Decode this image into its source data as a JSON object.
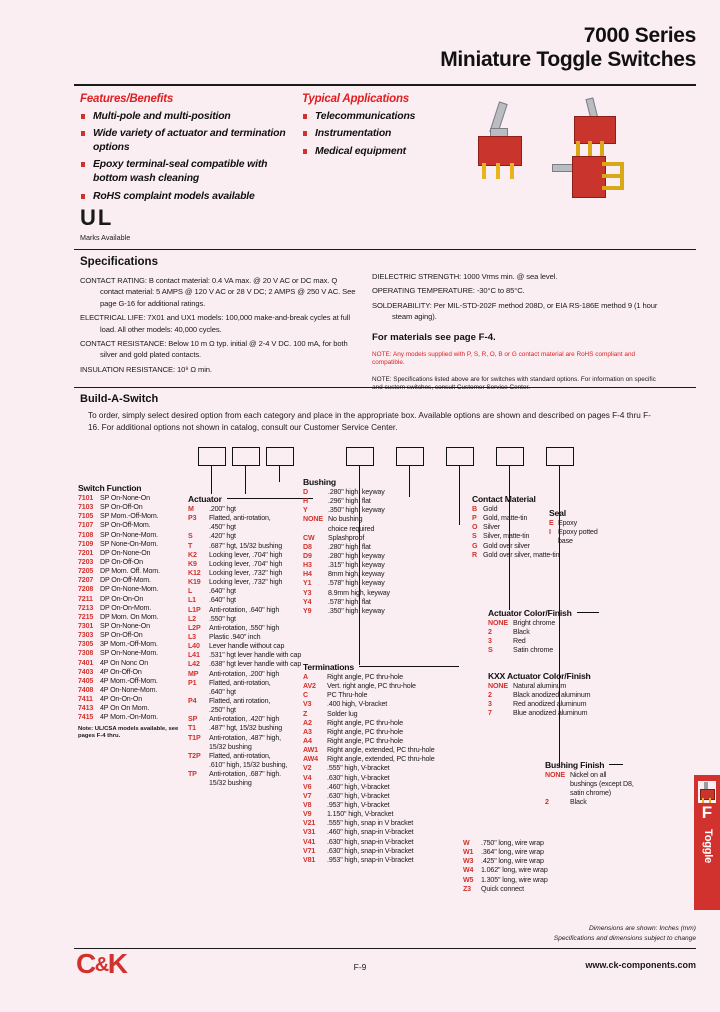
{
  "header": {
    "series": "7000 Series",
    "title": "Miniature Toggle Switches"
  },
  "features": {
    "heading": "Features/Benefits",
    "items": [
      "Multi-pole and multi-position",
      "Wide variety of actuator and termination options",
      "Epoxy terminal-seal compatible with bottom wash cleaning",
      "RoHS complaint models available"
    ]
  },
  "applications": {
    "heading": "Typical Applications",
    "items": [
      "Telecommunications",
      "Instrumentation",
      "Medical equipment"
    ]
  },
  "marks": {
    "glyphs": "UL",
    "note": "Marks Available"
  },
  "specifications": {
    "heading": "Specifications",
    "left": [
      "CONTACT RATING: B contact material: 0.4 VA max. @ 20 V AC or DC max. Q contact material: 5 AMPS @ 120 V AC or 28 V DC; 2 AMPS @ 250 V AC. See page G-16 for additional ratings.",
      "ELECTRICAL LIFE: 7X01 and UX1 models: 100,000 make-and-break cycles at full load. All other models: 40,000 cycles.",
      "CONTACT RESISTANCE: Below 10 m Ω typ. initial @ 2-4 V DC. 100 mA, for both silver and gold plated contacts.",
      "INSULATION RESISTANCE: 10⁹ Ω min."
    ],
    "right": [
      "DIELECTRIC STRENGTH: 1000 Vrms min. @ sea level.",
      "OPERATING TEMPERATURE: -30°C to 85°C.",
      "SOLDERABILITY: Per MIL-STD-202F method 208D, or EIA RS-186E method 9 (1 hour steam aging)."
    ],
    "materials_line": "For materials see page F-4.",
    "note_red": "NOTE: Any models supplied with P, S, R, O, B or G contact material are RoHS compliant and compatible.",
    "note_black": "NOTE: Specifications listed above are for switches with standard options. For information on specific and custom switches, consult Customer Service Center."
  },
  "build": {
    "heading": "Build-A-Switch",
    "intro": "To order, simply select desired option from each category and place in the appropriate box. Available options are shown and described on pages F-4 thru F-16. For additional options not shown in catalog, consult our Customer Service Center."
  },
  "columns": {
    "switch_function": {
      "title": "Switch Function",
      "rows": [
        {
          "code": "7101",
          "desc": "SP On-None-On"
        },
        {
          "code": "7103",
          "desc": "SP On-Off-On"
        },
        {
          "code": "7105",
          "desc": "SP Mom.-Off-Mom."
        },
        {
          "code": "7107",
          "desc": "SP On-Off-Mom."
        },
        {
          "code": "7108",
          "desc": "SP On-None-Mom."
        },
        {
          "code": "7109",
          "desc": "SP None-On-Mom."
        },
        {
          "code": "7201",
          "desc": "DP On-None-On"
        },
        {
          "code": "7203",
          "desc": "DP On-Off-On"
        },
        {
          "code": "7205",
          "desc": "DP Mom. Off. Mom."
        },
        {
          "code": "7207",
          "desc": "DP On-Off-Mom."
        },
        {
          "code": "7208",
          "desc": "DP On-None-Mom."
        },
        {
          "code": "7211",
          "desc": "DP On-On-On"
        },
        {
          "code": "7213",
          "desc": "DP On-On-Mom."
        },
        {
          "code": "7215",
          "desc": "DP Mom. On Mom."
        },
        {
          "code": "7301",
          "desc": "SP On-None-On"
        },
        {
          "code": "7303",
          "desc": "SP On-Off-On"
        },
        {
          "code": "7305",
          "desc": "3P Mom.-Off-Mom."
        },
        {
          "code": "7308",
          "desc": "SP On-None-Mom."
        },
        {
          "code": "7401",
          "desc": "4P On Nonc On"
        },
        {
          "code": "7403",
          "desc": "4P On-Off-On"
        },
        {
          "code": "7405",
          "desc": "4P Mom.-Off-Mom."
        },
        {
          "code": "7408",
          "desc": "4P On-None-Mom."
        },
        {
          "code": "7411",
          "desc": "4P On-On-On"
        },
        {
          "code": "7413",
          "desc": "4P On On Mom."
        },
        {
          "code": "7415",
          "desc": "4P Mom.-On-Mom."
        }
      ],
      "note": "Note: UL/CSA models available, see pages F-4 thru."
    },
    "actuator": {
      "title": "Actuator",
      "rows": [
        {
          "code": "M",
          "desc": ".200\" hgt"
        },
        {
          "code": "P3",
          "desc": "Flatted, anti-rotation,"
        },
        {
          "code": "",
          "desc": ".450\" hgt"
        },
        {
          "code": "S",
          "desc": ".420\" hgt"
        },
        {
          "code": "T",
          "desc": ".687\" hgt, 15/32 bushing"
        },
        {
          "code": "K2",
          "desc": "Locking lever, .704\" high"
        },
        {
          "code": "K9",
          "desc": "Locking lever, .704\" high"
        },
        {
          "code": "K12",
          "desc": "Locking lever, .732\" high"
        },
        {
          "code": "K19",
          "desc": "Locking lever, .732\" high"
        },
        {
          "code": "L",
          "desc": ".640\" hgt"
        },
        {
          "code": "L1",
          "desc": ".640\" hgt"
        },
        {
          "code": "L1P",
          "desc": "Anti-rotation, .640\" high"
        },
        {
          "code": "L2",
          "desc": ".550\" hgt"
        },
        {
          "code": "L2P",
          "desc": "Anti-rotation, .550\" high"
        },
        {
          "code": "L3",
          "desc": "Plastic .940\" inch"
        },
        {
          "code": "L40",
          "desc": "Lever handle without cap"
        },
        {
          "code": "L41",
          "desc": ".531\" hgt lever handle with cap"
        },
        {
          "code": "L42",
          "desc": ".638\" hgt lever handle with cap"
        },
        {
          "code": "MP",
          "desc": "Anti-rotation, .200\" high"
        },
        {
          "code": "P1",
          "desc": "Flatted, anti-rotation,"
        },
        {
          "code": "",
          "desc": ".640\" hgt"
        },
        {
          "code": "P4",
          "desc": "Flatted, anti rotation,"
        },
        {
          "code": "",
          "desc": ".250\" hgt"
        },
        {
          "code": "SP",
          "desc": "Anti-rotation, .420\" high"
        },
        {
          "code": "T1",
          "desc": ".487\" hgt, 15/32 bushing"
        },
        {
          "code": "T1P",
          "desc": "Anti-rotation, .487\" high,"
        },
        {
          "code": "",
          "desc": "15/32 bushing"
        },
        {
          "code": "T2P",
          "desc": "Flatted, anti-rotation,"
        },
        {
          "code": "",
          "desc": ".610\" high, 15/32 bushing,"
        },
        {
          "code": "TP",
          "desc": "Anti-rotation, .687\" high."
        },
        {
          "code": "",
          "desc": "15/32 bushing"
        }
      ]
    },
    "bushing": {
      "title": "Bushing",
      "rows": [
        {
          "code": "D",
          "desc": ".280\" high, keyway"
        },
        {
          "code": "H",
          "desc": ".296\" high, flat"
        },
        {
          "code": "Y",
          "desc": ".350\" high, keyway"
        },
        {
          "code": "NONE",
          "desc": "No bushing"
        },
        {
          "code": "",
          "desc": "choice required"
        },
        {
          "code": "CW",
          "desc": "Splashproof"
        },
        {
          "code": "D8",
          "desc": ".280\" high, flat"
        },
        {
          "code": "D9",
          "desc": ".280\" high, keyway"
        },
        {
          "code": "H3",
          "desc": ".315\" high, keyway"
        },
        {
          "code": "H4",
          "desc": "8mm high, keyway"
        },
        {
          "code": "Y1",
          "desc": ".578\" high, keyway"
        },
        {
          "code": "Y3",
          "desc": "8.9mm high, keyway"
        },
        {
          "code": "Y4",
          "desc": ".578\" high, flat"
        },
        {
          "code": "Y9",
          "desc": ".350\" high, keyway"
        }
      ]
    },
    "terminations": {
      "title": "Terminations",
      "rows": [
        {
          "code": "A",
          "desc": "Right angle, PC thru-hole"
        },
        {
          "code": "AV2",
          "desc": "Vert. right angle, PC thru-hole"
        },
        {
          "code": "C",
          "desc": "PC Thru-hole"
        },
        {
          "code": "V3",
          "desc": ".400 high, V-bracket"
        },
        {
          "code": "Z",
          "desc": "Solder lug"
        },
        {
          "code": "A2",
          "desc": "Right angle, PC thru-hole"
        },
        {
          "code": "A3",
          "desc": "Right angle, PC thru-hole"
        },
        {
          "code": "A4",
          "desc": "Right angle, PC thru-hole"
        },
        {
          "code": "AW1",
          "desc": "Right angle, extended, PC thru-hole"
        },
        {
          "code": "AW4",
          "desc": "Right angle, extended, PC thru-hole"
        },
        {
          "code": "V2",
          "desc": ".555\" high, V-bracket"
        },
        {
          "code": "V4",
          "desc": ".630\" high, V-bracket"
        },
        {
          "code": "V6",
          "desc": ".460\" high, V-bracket"
        },
        {
          "code": "V7",
          "desc": ".630\" high, V-bracket"
        },
        {
          "code": "V8",
          "desc": ".953\" high, V-bracket"
        },
        {
          "code": "V9",
          "desc": "1.150\" high, V-bracket"
        },
        {
          "code": "V21",
          "desc": ".555\" high, snap in V bracket"
        },
        {
          "code": "V31",
          "desc": ".460\" high, snap-in V-bracket"
        },
        {
          "code": "V41",
          "desc": ".630\" high, snap-in V-bracket"
        },
        {
          "code": "V71",
          "desc": ".630\" high, snap-in V-bracket"
        },
        {
          "code": "V81",
          "desc": ".953\" high, snap-in V-bracket"
        }
      ],
      "wire_rows": [
        {
          "code": "W",
          "desc": ".750\" long, wire wrap"
        },
        {
          "code": "W1",
          "desc": ".364\" long, wire wrap"
        },
        {
          "code": "W3",
          "desc": ".425\" long, wire wrap"
        },
        {
          "code": "W4",
          "desc": "1.062\" long, wire wrap"
        },
        {
          "code": "W5",
          "desc": "1.305\" long, wire wrap"
        },
        {
          "code": "Z3",
          "desc": "Quick connect"
        }
      ]
    },
    "contact_material": {
      "title": "Contact Material",
      "rows": [
        {
          "code": "B",
          "desc": "Gold"
        },
        {
          "code": "P",
          "desc": "Gold, matte-tin"
        },
        {
          "code": "O",
          "desc": "Silver"
        },
        {
          "code": "S",
          "desc": "Silver, matte-tin"
        },
        {
          "code": "G",
          "desc": "Gold over silver"
        },
        {
          "code": "R",
          "desc": "Gold over silver, matte-tin"
        }
      ]
    },
    "seal": {
      "title": "Seal",
      "rows": [
        {
          "code": "E",
          "desc": "Epoxy"
        },
        {
          "code": "I",
          "desc": "Epoxy potted"
        },
        {
          "code": "",
          "desc": "base"
        }
      ]
    },
    "actuator_color": {
      "title": "Actuator Color/Finish",
      "rows": [
        {
          "code": "NONE",
          "desc": "Bright chrome"
        },
        {
          "code": "2",
          "desc": "Black"
        },
        {
          "code": "3",
          "desc": "Red"
        },
        {
          "code": "S",
          "desc": "Satin chrome"
        }
      ]
    },
    "kxx_actuator_color": {
      "title": "KXX Actuator Color/Finish",
      "rows": [
        {
          "code": "NONE",
          "desc": "Natural aluminum"
        },
        {
          "code": "2",
          "desc": "Black anodized aluminum"
        },
        {
          "code": "3",
          "desc": "Red anodized aluminum"
        },
        {
          "code": "7",
          "desc": "Blue anodized aluminum"
        }
      ]
    },
    "bushing_finish": {
      "title": "Bushing Finish",
      "rows": [
        {
          "code": "NONE",
          "desc": "Nickel on all"
        },
        {
          "code": "",
          "desc": "bushings (except D8,"
        },
        {
          "code": "",
          "desc": "satin chrome)"
        },
        {
          "code": "2",
          "desc": "Black"
        }
      ]
    }
  },
  "tab": {
    "letter": "F",
    "label": "Toggle"
  },
  "footer": {
    "note_line1": "Dimensions are shown: Inches (mm)",
    "note_line2": "Specifications and dimensions subject to change",
    "logo": "C&K",
    "page": "F-9",
    "url": "www.ck-components.com"
  }
}
